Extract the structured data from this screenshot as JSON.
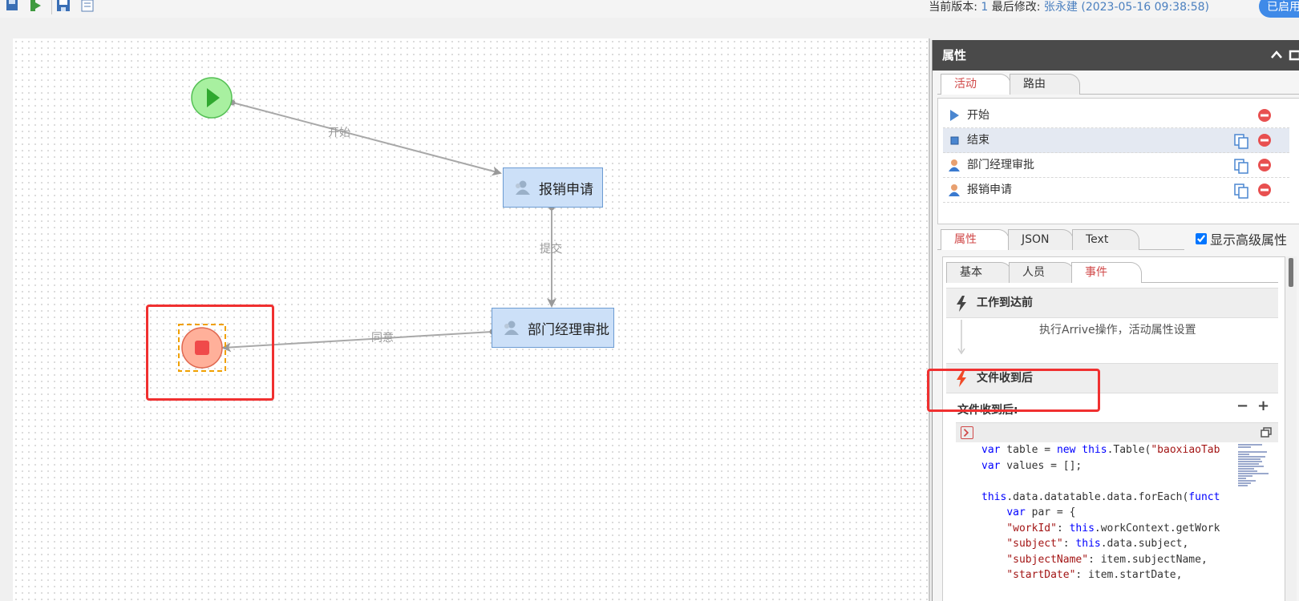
{
  "toolbar": {
    "icons": [
      "save-icon",
      "publish-icon",
      "save-as-icon",
      "document-icon"
    ],
    "version_label": "当前版本:",
    "version_value": "1",
    "modified_label": "最后修改:",
    "modified_by": "张永建",
    "modified_time": "(2023-05-16 09:38:58)",
    "status_label": "已启用"
  },
  "flow": {
    "nodes": {
      "start": "start-node",
      "apply": "报销申请",
      "approve": "部门经理审批",
      "end": "end-node"
    },
    "edges": {
      "start_to_apply": "开始",
      "apply_to_approve": "提交",
      "approve_to_end": "同意"
    }
  },
  "panel": {
    "title": "属性",
    "top_tabs": [
      "活动",
      "路由"
    ],
    "activities": [
      {
        "label": "开始",
        "icon": "start-triangle-icon",
        "copy": false
      },
      {
        "label": "结束",
        "icon": "end-square-icon",
        "copy": true
      },
      {
        "label": "部门经理审批",
        "icon": "user-icon",
        "copy": true
      },
      {
        "label": "报销申请",
        "icon": "user-icon",
        "copy": true
      }
    ],
    "prop_tabs": [
      "属性",
      "JSON",
      "Text"
    ],
    "advanced_label": "显示高级属性",
    "advanced_checked": true,
    "sub_tabs": [
      "基本",
      "人员",
      "事件"
    ],
    "events": {
      "arrive_title": "工作到达前",
      "arrive_desc": "执行Arrive操作，活动属性设置",
      "received_title": "文件收到后",
      "received_sub": "文件收到后:",
      "minus": "−",
      "plus": "+"
    },
    "code_lines": [
      [
        {
          "t": "var",
          "c": "kw"
        },
        {
          "t": " table = "
        },
        {
          "t": "new",
          "c": "kw"
        },
        {
          "t": " "
        },
        {
          "t": "this",
          "c": "kw"
        },
        {
          "t": ".Table("
        },
        {
          "t": "\"baoxiaoTab",
          "c": "st"
        }
      ],
      [
        {
          "t": "var",
          "c": "kw"
        },
        {
          "t": " values = [];"
        }
      ],
      [
        {
          "t": ""
        }
      ],
      [
        {
          "t": "this",
          "c": "kw"
        },
        {
          "t": ".data.datatable.data.forEach("
        },
        {
          "t": "funct",
          "c": "kw"
        }
      ],
      [
        {
          "t": "    "
        },
        {
          "t": "var",
          "c": "kw"
        },
        {
          "t": " par = {"
        }
      ],
      [
        {
          "t": "    "
        },
        {
          "t": "\"workId\"",
          "c": "st"
        },
        {
          "t": ": "
        },
        {
          "t": "this",
          "c": "kw"
        },
        {
          "t": ".workContext.getWork"
        }
      ],
      [
        {
          "t": "    "
        },
        {
          "t": "\"subject\"",
          "c": "st"
        },
        {
          "t": ": "
        },
        {
          "t": "this",
          "c": "kw"
        },
        {
          "t": ".data.subject,"
        }
      ],
      [
        {
          "t": "    "
        },
        {
          "t": "\"subjectName\"",
          "c": "st"
        },
        {
          "t": ": item.subjectName,"
        }
      ],
      [
        {
          "t": "    "
        },
        {
          "t": "\"startDate\"",
          "c": "st"
        },
        {
          "t": ": item.startDate,"
        }
      ]
    ]
  }
}
